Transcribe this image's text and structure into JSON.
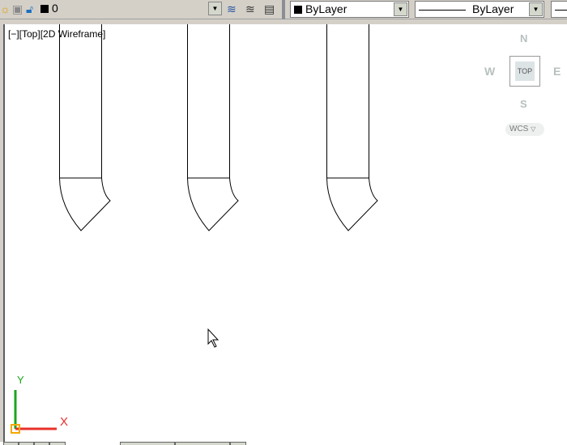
{
  "toolbar": {
    "layer_value": "0",
    "color_value": "ByLayer",
    "linetype_value": "ByLayer",
    "icons": [
      "lightbulb-icon",
      "freeze-icon",
      "unlock-icon",
      "layer-color-icon",
      "make-current-layer-icon",
      "layer-previous-icon",
      "layer-state-icon"
    ]
  },
  "viewport": {
    "label": "[−][Top][2D Wireframe]",
    "viewcube": {
      "north": "N",
      "south": "S",
      "east": "E",
      "west": "W",
      "face": "TOP",
      "ucs": "WCS"
    },
    "ucs_icon": {
      "x_label": "X",
      "y_label": "Y"
    }
  }
}
